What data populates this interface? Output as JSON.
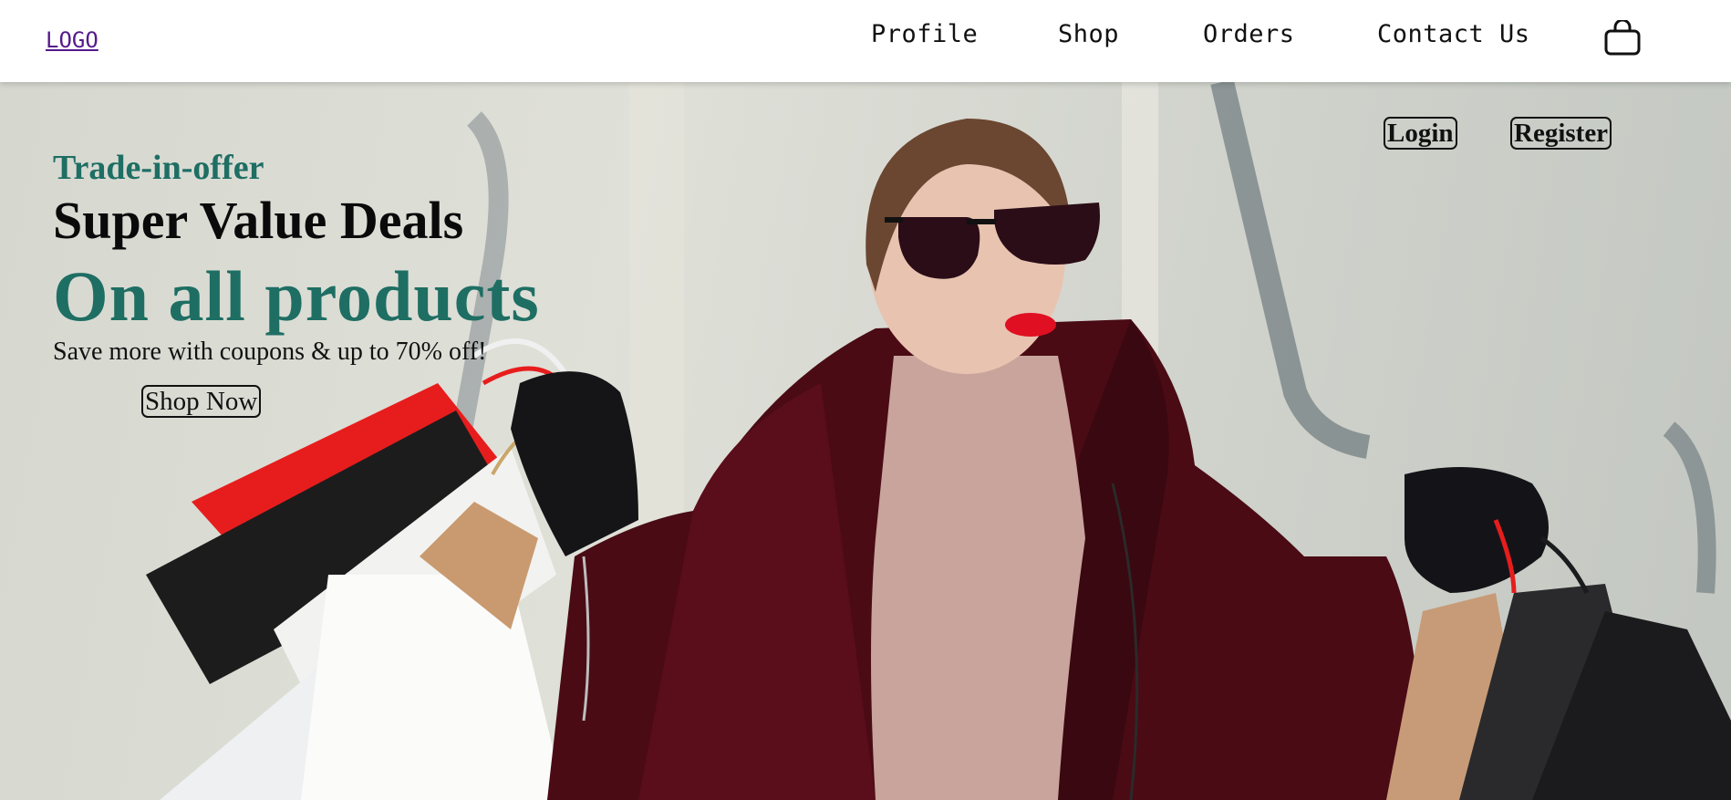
{
  "nav": {
    "logo": "LOGO",
    "links": [
      "Profile",
      "Shop",
      "Orders",
      "Contact Us"
    ],
    "cart_icon": "shopping-bag-icon"
  },
  "hero": {
    "eyebrow": "Trade-in-offer",
    "headline": "Super Value Deals",
    "subheadline": "On all products",
    "tagline": "Save more with coupons & up to 70% off!",
    "cta": "Shop Now",
    "login": "Login",
    "register": "Register",
    "image": "woman-with-shopping-bags",
    "accent_color": "#1e6e63"
  }
}
